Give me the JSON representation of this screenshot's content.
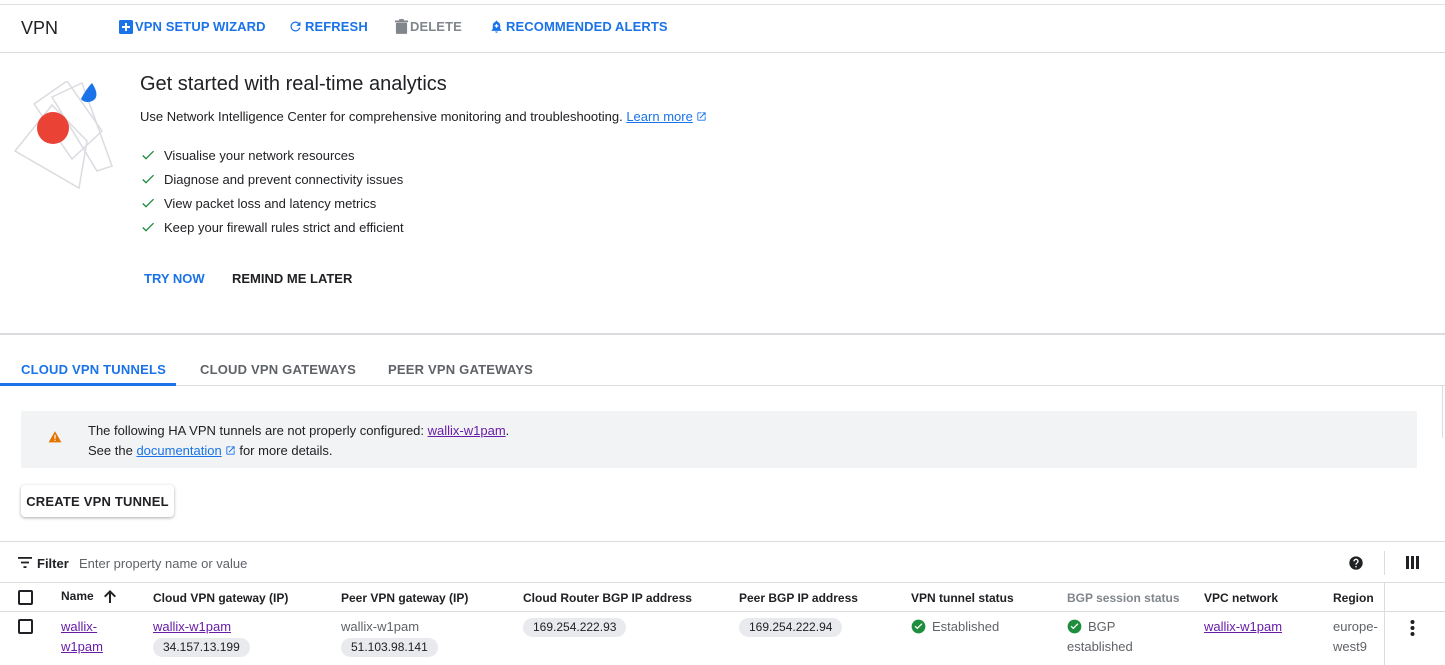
{
  "header": {
    "title": "VPN",
    "actions": {
      "setup_wizard": "VPN SETUP WIZARD",
      "refresh": "REFRESH",
      "delete": "DELETE",
      "alerts": "RECOMMENDED ALERTS"
    }
  },
  "promo": {
    "title": "Get started with real-time analytics",
    "description": "Use Network Intelligence Center for comprehensive monitoring and troubleshooting.",
    "learn_more": "Learn more",
    "features": [
      "Visualise your network resources",
      "Diagnose and prevent connectivity issues",
      "View packet loss and latency metrics",
      "Keep your firewall rules strict and efficient"
    ],
    "try_now": "TRY NOW",
    "remind_later": "REMIND ME LATER"
  },
  "tabs": [
    "CLOUD VPN TUNNELS",
    "CLOUD VPN GATEWAYS",
    "PEER VPN GATEWAYS"
  ],
  "warning": {
    "line1_prefix": "The following HA VPN tunnels are not properly configured: ",
    "tunnel_link": "wallix-w1pam",
    "line1_suffix": ".",
    "line2_prefix": "See the ",
    "doc_link": "documentation",
    "line2_suffix": " for more details."
  },
  "create_button": "CREATE VPN TUNNEL",
  "filter": {
    "label": "Filter",
    "placeholder": "Enter property name or value"
  },
  "table": {
    "columns": {
      "name": "Name",
      "cloud_gw": "Cloud VPN gateway (IP)",
      "peer_gw": "Peer VPN gateway (IP)",
      "router_bgp": "Cloud Router BGP IP address",
      "peer_bgp": "Peer BGP IP address",
      "tunnel_status": "VPN tunnel status",
      "bgp_status": "BGP session status",
      "vpc": "VPC network",
      "region": "Region"
    },
    "rows": [
      {
        "name_l1": "wallix-",
        "name_l2": "w1pam",
        "cloud_gw_name": "wallix-w1pam",
        "cloud_gw_ip": "34.157.13.199",
        "peer_gw_name": "wallix-w1pam",
        "peer_gw_ip": "51.103.98.141",
        "router_bgp": "169.254.222.93",
        "peer_bgp": "169.254.222.94",
        "tunnel_status": "Established",
        "bgp_status_l1": "BGP",
        "bgp_status_l2": "established",
        "vpc": "wallix-w1pam",
        "region_l1": "europe-",
        "region_l2": "west9"
      }
    ]
  },
  "colors": {
    "accent": "#1a73e8",
    "success": "#1e8e3e",
    "warning": "#e37400",
    "visited_link": "#681da8"
  }
}
